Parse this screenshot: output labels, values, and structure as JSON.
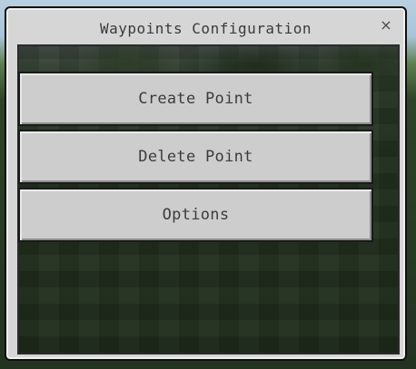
{
  "dialog": {
    "title": "Waypoints Configuration",
    "close_glyph": "×"
  },
  "buttons": {
    "create_point": "Create Point",
    "delete_point": "Delete Point",
    "options": "Options"
  },
  "icons": {
    "close": "close-icon"
  },
  "colors": {
    "dialog_background": "#d6d6d6",
    "button_background": "#cdcdcd",
    "button_text": "#3c3c3c",
    "title_text": "#3a3a3a"
  }
}
